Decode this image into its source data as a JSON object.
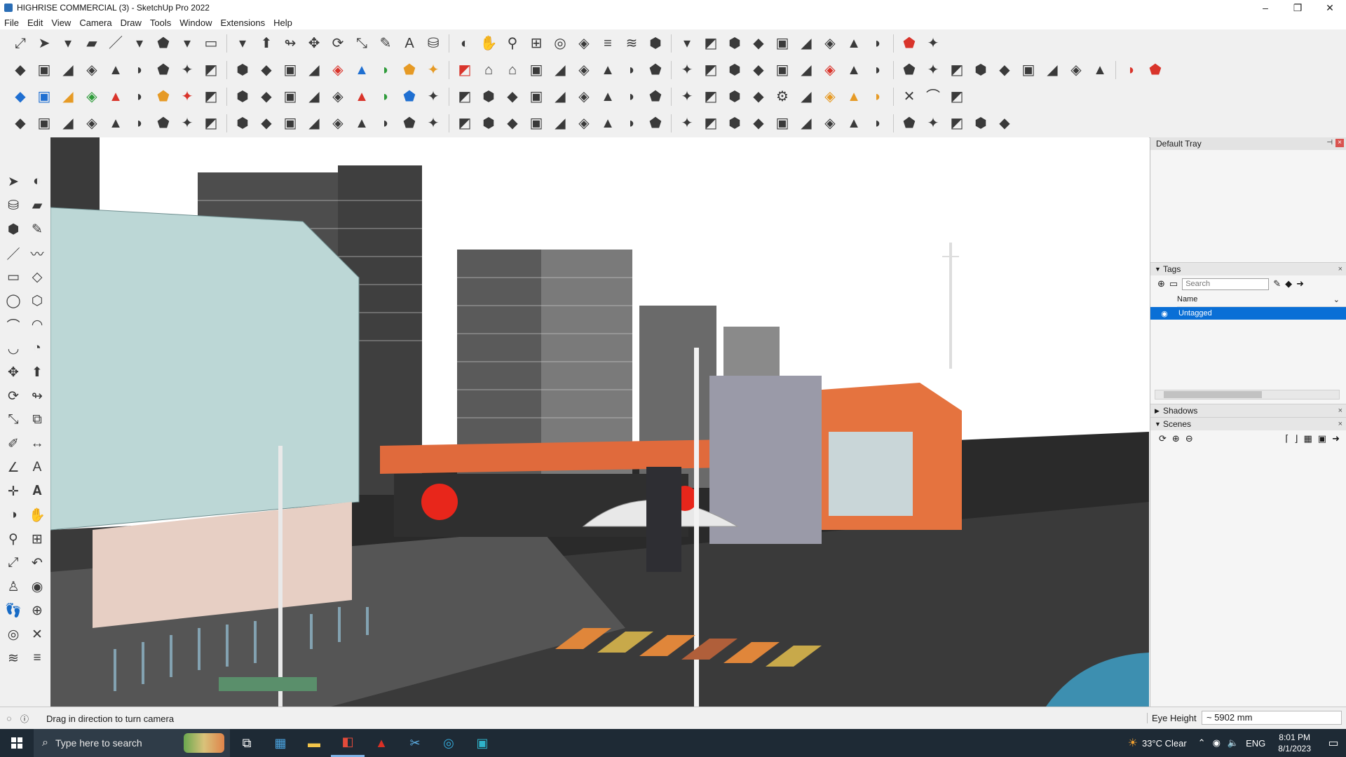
{
  "window": {
    "title": "HIGHRISE COMMERCIAL (3) - SketchUp Pro 2022"
  },
  "menu": [
    "File",
    "Edit",
    "View",
    "Camera",
    "Draw",
    "Tools",
    "Window",
    "Extensions",
    "Help"
  ],
  "toolbar_rows": [
    [
      "zoom-extents-icon",
      "select-icon",
      "dropdown-icon",
      "eraser-icon",
      "line-icon",
      "dropdown-icon",
      "lasso-icon",
      "dropdown-icon",
      "rectangle-icon",
      "dropdown-icon",
      "push-pull-icon",
      "follow-me-icon",
      "move-icon",
      "rotate-icon",
      "scale-icon",
      "tape-measure-icon",
      "text-icon",
      "paint-bucket-icon",
      "orbit-icon",
      "pan-icon",
      "zoom-icon",
      "zoom-window-icon",
      "section-plane-icon",
      "display-section-icon",
      "section-fill-icon",
      "section-cut-icon",
      "components-icon",
      "dropdown-icon",
      "get-models-icon",
      "share-model-icon",
      "extension-warehouse-icon",
      "sandbox-icon",
      "up-down-icon",
      "fit-icon",
      "front-icon",
      "undo-icon",
      "redo-icon",
      "warehouse-icon"
    ],
    [
      "iso-view-icon",
      "top-view-icon",
      "front-view-icon",
      "right-view-icon",
      "back-view-icon",
      "left-view-icon",
      "wireframe-icon",
      "hidden-line-icon",
      "shaded-icon",
      "shaded-texture-icon",
      "monochrome-icon",
      "x-ray-icon",
      "back-edges-icon",
      "axis-red-icon",
      "axis-blue-icon",
      "axis-green-icon",
      "axis-orange-icon",
      "axis-yellow-icon",
      "axis-pink-icon",
      "house-icon",
      "house-outline-icon",
      "garage-icon",
      "house-solid-icon",
      "building-icon",
      "solid-union-icon",
      "solid-subtract-icon",
      "solid-intersect-icon",
      "solid-trim-icon",
      "solid-split-icon",
      "solid-outer-icon",
      "solid-shell-icon",
      "function-icon",
      "paint-icon",
      "pencil-red-icon",
      "shape-1-icon",
      "shape-2-icon",
      "shape-3-icon",
      "shape-4-icon",
      "shape-5-icon",
      "shape-6-icon",
      "shape-7-icon",
      "shape-8-icon",
      "shape-9-icon",
      "shape-10-icon",
      "shape-11-icon",
      "red-arrow-icon",
      "pink-eraser-icon"
    ],
    [
      "blue-tile-icon",
      "blue-diamond-icon",
      "yellow-diamond-icon",
      "green-diamond-icon",
      "red-diamond-icon",
      "white-diamond-icon",
      "orange-curve-icon",
      "red-square-icon",
      "grid-icon",
      "door-icon",
      "box-icon",
      "chain-icon",
      "curve-icon",
      "bezier-icon",
      "red-cross-icon",
      "green-cross-icon",
      "blue-cross-icon",
      "cone-icon",
      "cone2-icon",
      "pyramid-icon",
      "spring-icon",
      "swirl-icon",
      "spiral-icon",
      "star-icon",
      "cube-icon",
      "hook-icon",
      "recycle-icon",
      "robot-icon",
      "robot2-icon",
      "robot3-icon",
      "gem-icon",
      "gear-icon",
      "chart-icon",
      "grid-orange-icon",
      "grid-orange2-icon",
      "grid-orange3-icon",
      "close-x-icon",
      "arc-icon",
      "grid-small-icon"
    ],
    [
      "draw-line-1-icon",
      "draw-line-2-icon",
      "car-icon",
      "scissors-icon",
      "gear-outline-icon",
      "paint-tool-icon",
      "hook-tool-icon",
      "globe-tool-icon",
      "helmet-icon",
      "arc-tool-icon",
      "corner-icon",
      "corner2-icon",
      "corner3-icon",
      "slide-icon",
      "crate-icon",
      "light-icon",
      "stairs-icon",
      "stairs2-icon",
      "grab-icon",
      "lantern-icon",
      "arrow-head-icon",
      "book-icon",
      "slash-icon",
      "fence-icon",
      "fence2-icon",
      "fence3-icon",
      "pattern-1-icon",
      "pattern-2-icon",
      "pattern-3-icon",
      "pattern-4-icon",
      "pattern-5-icon",
      "pattern-6-icon",
      "pattern-7-icon",
      "pattern-8-icon",
      "pattern-9-icon",
      "pattern-10-icon",
      "pattern-11-icon",
      "pattern-12-icon",
      "pattern-13-icon",
      "pattern-14-icon",
      "home-outline-icon"
    ]
  ],
  "palette": [
    [
      "select-icon",
      "orbit-icon"
    ],
    [
      "paint-bucket-icon",
      "eraser-icon"
    ],
    [
      "components-icon",
      "tape-measure-icon"
    ],
    [
      "line-icon",
      "freehand-icon"
    ],
    [
      "rectangle-icon",
      "rotated-rectangle-icon"
    ],
    [
      "circle-icon",
      "polygon-icon"
    ],
    [
      "arc-icon",
      "two-point-arc-icon"
    ],
    [
      "three-point-arc-icon",
      "pie-icon"
    ],
    [
      "move-icon",
      "push-pull-icon"
    ],
    [
      "rotate-icon",
      "follow-me-icon"
    ],
    [
      "scale-icon",
      "offset-icon"
    ],
    [
      "tape-icon",
      "dimension-icon"
    ],
    [
      "protractor-icon",
      "text-icon"
    ],
    [
      "axes-icon",
      "three-d-text-icon"
    ],
    [
      "orbit-tool-icon",
      "pan-icon"
    ],
    [
      "zoom-icon",
      "zoom-window-icon"
    ],
    [
      "zoom-extents-icon",
      "previous-view-icon"
    ],
    [
      "position-camera-icon",
      "look-around-icon"
    ],
    [
      "walk-icon",
      "section-icon"
    ],
    [
      "section-plane-icon",
      "display-sections-icon"
    ],
    [
      "section-cut-icon",
      "section-fill-icon"
    ]
  ],
  "tray": {
    "title": "Default Tray",
    "pin": "⊣",
    "close": "×",
    "tags": {
      "label": "Tags",
      "search_placeholder": "Search",
      "column": "Name",
      "items": [
        {
          "name": "Untagged"
        }
      ]
    },
    "shadows": "Shadows",
    "scenes": "Scenes"
  },
  "status": {
    "message": "Drag in direction to turn camera",
    "eye_label": "Eye Height",
    "eye_value": "~ 5902 mm"
  },
  "taskbar": {
    "search_placeholder": "Type here to search",
    "weather": "33°C  Clear",
    "language": "ENG",
    "time": "8:01 PM",
    "date": "8/1/2023"
  }
}
